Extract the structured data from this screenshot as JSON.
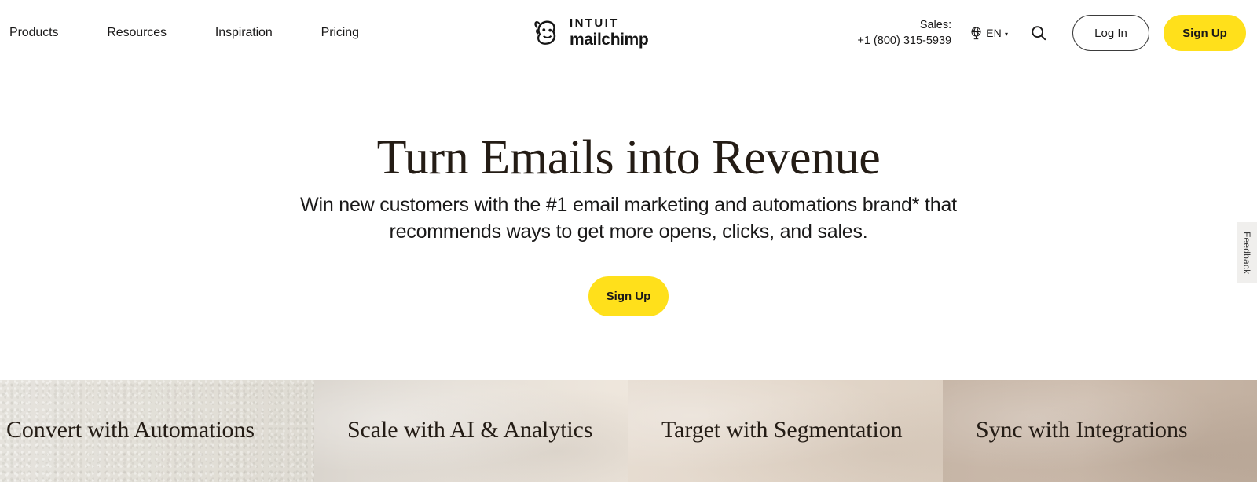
{
  "header": {
    "nav": [
      {
        "label": "Products"
      },
      {
        "label": "Resources"
      },
      {
        "label": "Inspiration"
      },
      {
        "label": "Pricing"
      }
    ],
    "logo": {
      "brand_top": "INTUIT",
      "brand_bottom": "mailchimp",
      "mark": "freddie-chimp-icon"
    },
    "sales": {
      "label": "Sales:",
      "phone": "+1 (800) 315-5939"
    },
    "language": {
      "code": "EN",
      "caret": "▾",
      "icon": "globe-icon"
    },
    "search": {
      "icon": "search-icon"
    },
    "login_label": "Log In",
    "signup_label": "Sign Up"
  },
  "hero": {
    "title": "Turn Emails into Revenue",
    "subtitle": "Win new customers with the #1 email marketing and automations brand* that recommends ways to get more opens, clicks, and sales.",
    "cta_label": "Sign Up"
  },
  "cards": [
    {
      "title": "Convert with Automations"
    },
    {
      "title": "Scale with AI & Analytics"
    },
    {
      "title": "Target with Segmentation"
    },
    {
      "title": "Sync with Integrations"
    }
  ],
  "feedback": {
    "label": "Feedback"
  },
  "colors": {
    "brand_yellow": "#ffe01b",
    "text_dark": "#1a1919",
    "heading": "#241c15",
    "card_1": "#eceae5",
    "card_2": "#ded9d2",
    "card_3": "#e2d6c9",
    "card_4": "#c9b8a9",
    "feedback_bg": "#f0efed"
  }
}
